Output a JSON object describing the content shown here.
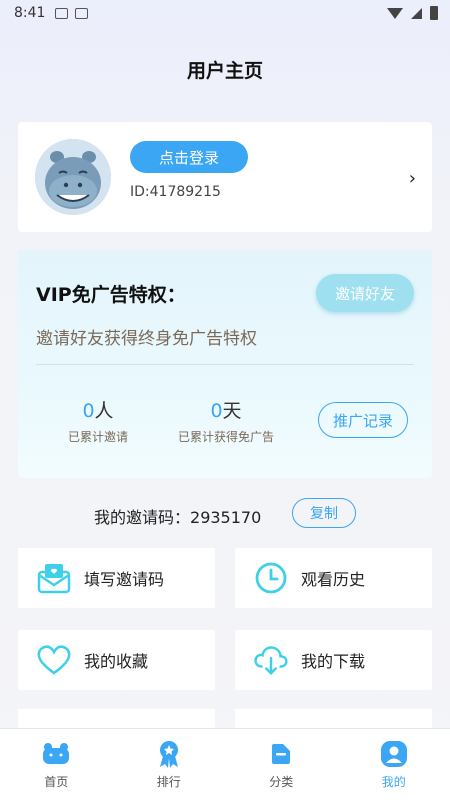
{
  "status_bar": {
    "time": "8:41"
  },
  "header": {
    "title": "用户主页"
  },
  "profile": {
    "login_label": "点击登录",
    "user_id": "ID:41789215",
    "arrow": "›"
  },
  "vip": {
    "title": "VIP免广告特权：",
    "invite_button": "邀请好友",
    "description": "邀请好友获得终身免广告特权",
    "stats": [
      {
        "value": "0",
        "unit": "人",
        "label": "已累计邀请"
      },
      {
        "value": "0",
        "unit": "天",
        "label": "已累计获得免广告"
      }
    ],
    "promo_button": "推广记录"
  },
  "invite_code": {
    "label": "我的邀请码：",
    "code": "2935170",
    "copy_label": "复制"
  },
  "menu": [
    {
      "label": "填写邀请码",
      "icon": "envelope-heart-icon"
    },
    {
      "label": "观看历史",
      "icon": "clock-icon"
    },
    {
      "label": "我的收藏",
      "icon": "heart-icon"
    },
    {
      "label": "我的下载",
      "icon": "cloud-download-icon"
    }
  ],
  "tabs": [
    {
      "label": "首页",
      "icon": "home-icon",
      "active": false
    },
    {
      "label": "排行",
      "icon": "ranking-icon",
      "active": false
    },
    {
      "label": "分类",
      "icon": "category-icon",
      "active": false
    },
    {
      "label": "我的",
      "icon": "profile-icon",
      "active": true
    }
  ],
  "colors": {
    "accent": "#3aa6f4",
    "icon_cyan": "#3fd0e8",
    "vip_bg": "#e6f6fb",
    "desc_brown": "#7a6a57"
  }
}
